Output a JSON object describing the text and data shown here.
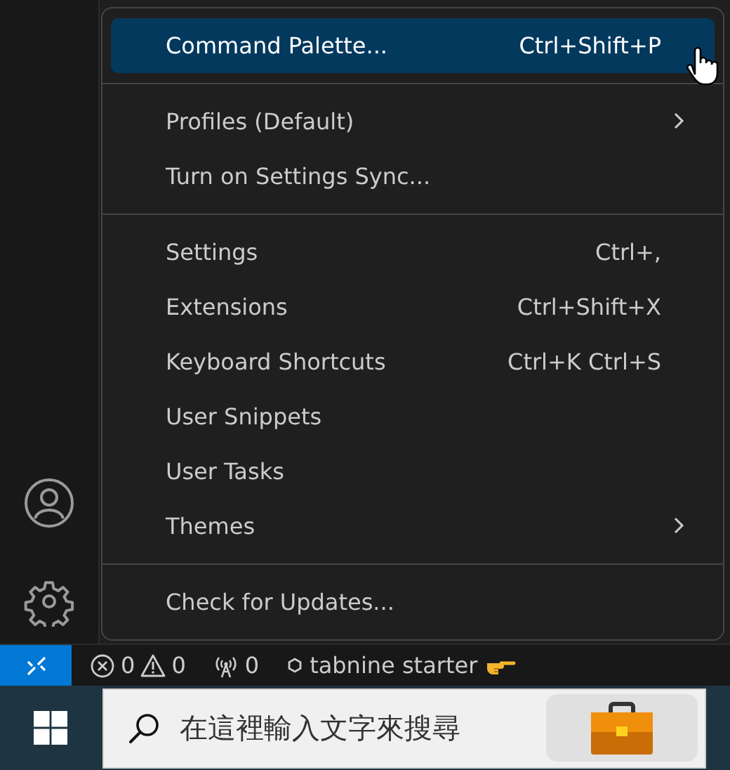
{
  "menu": {
    "groups": [
      {
        "items": [
          {
            "label": "Command Palette...",
            "shortcut": "Ctrl+Shift+P",
            "submenu": false,
            "selected": true
          }
        ]
      },
      {
        "items": [
          {
            "label": "Profiles (Default)",
            "submenu": true,
            "selected": false
          },
          {
            "label": "Turn on Settings Sync...",
            "submenu": false,
            "selected": false
          }
        ]
      },
      {
        "items": [
          {
            "label": "Settings",
            "shortcut": "Ctrl+,",
            "submenu": false,
            "selected": false
          },
          {
            "label": "Extensions",
            "shortcut": "Ctrl+Shift+X",
            "submenu": false,
            "selected": false
          },
          {
            "label": "Keyboard Shortcuts",
            "shortcut": "Ctrl+K Ctrl+S",
            "submenu": false,
            "selected": false
          },
          {
            "label": "User Snippets",
            "submenu": false,
            "selected": false
          },
          {
            "label": "User Tasks",
            "submenu": false,
            "selected": false
          },
          {
            "label": "Themes",
            "submenu": true,
            "selected": false
          }
        ]
      },
      {
        "items": [
          {
            "label": "Check for Updates...",
            "submenu": false,
            "selected": false
          }
        ]
      }
    ]
  },
  "status_bar": {
    "errors": "0",
    "warnings": "0",
    "ports": "0",
    "tabnine": "tabnine starter"
  },
  "taskbar": {
    "search": {
      "placeholder": "在這裡輸入文字來搜尋"
    }
  }
}
